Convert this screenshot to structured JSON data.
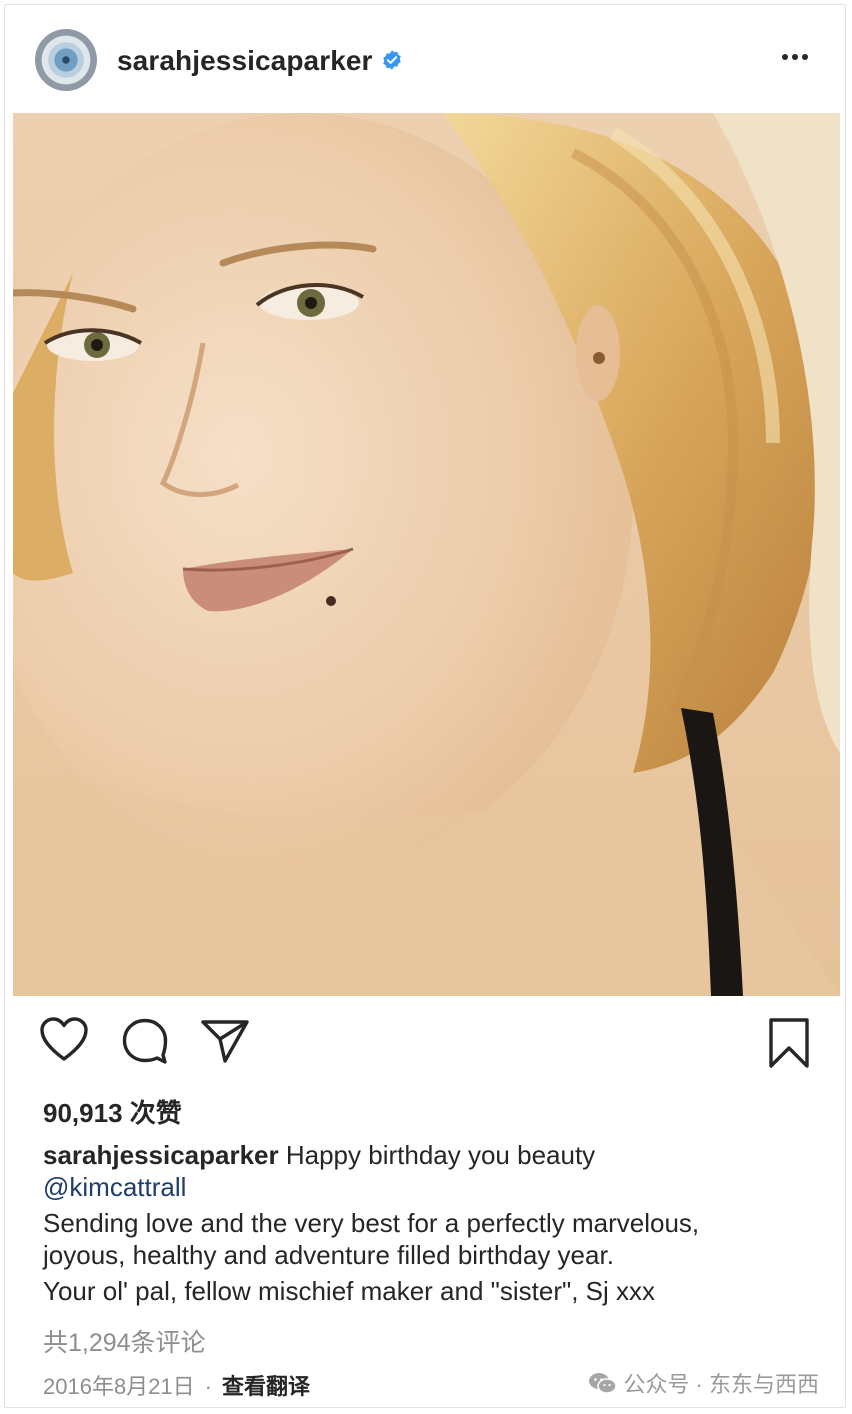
{
  "post": {
    "username": "sarahjessicaparker",
    "likes": "90,913 次赞",
    "caption": {
      "user": "sarahjessicaparker",
      "text_line1": "Happy birthday you beauty",
      "mention": "@kimcattrall",
      "text_line2": "Sending love and the very best for a perfectly marvelous,",
      "text_line3": "joyous, healthy and adventure filled birthday year.",
      "text_line4": "Your ol' pal, fellow mischief maker and \"sister\", Sj xxx"
    },
    "comments": "共1,294条评论",
    "date": "2016年8月21日",
    "separator": "·",
    "translate": "查看翻译"
  },
  "watermark": {
    "text": "公众号 · 东东与西西"
  },
  "icons": {
    "verified": "verified-badge-icon",
    "more": "more-options-icon",
    "like": "heart-icon",
    "comment": "comment-icon",
    "share": "send-icon",
    "save": "bookmark-icon"
  },
  "colors": {
    "verified": "#3897f0",
    "mention": "#1e3d6b",
    "muted": "#8e8e8e"
  }
}
